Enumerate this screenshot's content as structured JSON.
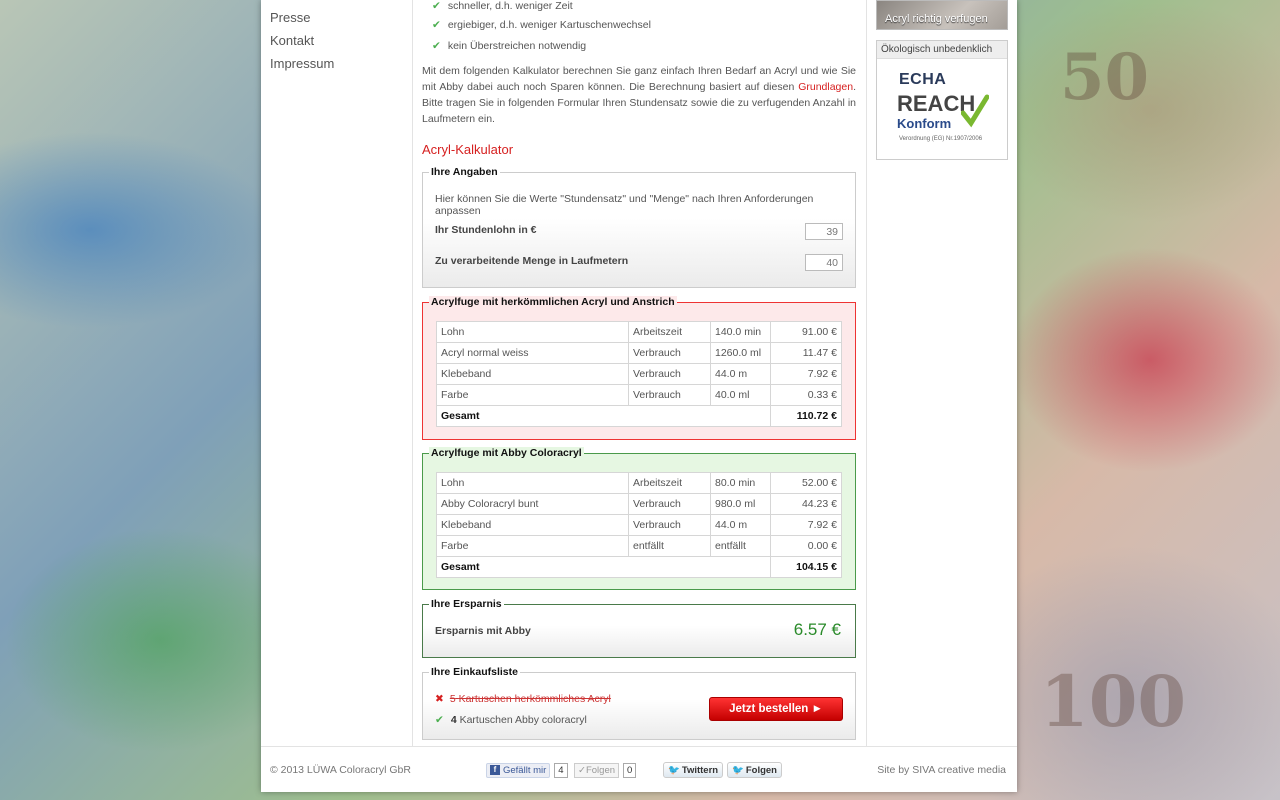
{
  "nav": {
    "items": [
      "Presse",
      "Kontakt",
      "Impressum"
    ]
  },
  "benefits": [
    "schneller, d.h. weniger Zeit",
    "ergiebiger, d.h. weniger Kartuschenwechsel",
    "kein Überstreichen notwendig"
  ],
  "intro": {
    "text_before": "Mit dem folgenden Kalkulator berechnen Sie ganz einfach Ihren Bedarf an Acryl und wie Sie mit Abby dabei auch noch Sparen können. Die Berechnung basiert auf diesen ",
    "link": "Grundlagen",
    "text_after": ". Bitte tragen Sie in folgenden Formular Ihren Stundensatz sowie die zu verfugenden Anzahl in Laufmetern ein."
  },
  "calculator": {
    "title": "Acryl-Kalkulator",
    "inputs": {
      "legend": "Ihre Angaben",
      "hint": "Hier können Sie die Werte \"Stundensatz\" und \"Menge\" nach Ihren Anforderungen anpassen",
      "wage_label": "Ihr Stundenlohn in €",
      "wage_value": "39",
      "quantity_label": "Zu verarbeitende Menge in Laufmetern",
      "quantity_value": "40"
    },
    "conventional": {
      "legend": "Acrylfuge mit herkömmlichen Acryl und Anstrich",
      "rows": [
        [
          "Lohn",
          "Arbeitszeit",
          "140.0 min",
          "91.00 €"
        ],
        [
          "Acryl normal weiss",
          "Verbrauch",
          "1260.0 ml",
          "11.47 €"
        ],
        [
          "Klebeband",
          "Verbrauch",
          "44.0 m",
          "7.92 €"
        ],
        [
          "Farbe",
          "Verbrauch",
          "40.0 ml",
          "0.33 €"
        ]
      ],
      "total_label": "Gesamt",
      "total_value": "110.72 €"
    },
    "abby": {
      "legend": "Acrylfuge mit Abby Coloracryl",
      "rows": [
        [
          "Lohn",
          "Arbeitszeit",
          "80.0 min",
          "52.00 €"
        ],
        [
          "Abby Coloracryl bunt",
          "Verbrauch",
          "980.0 ml",
          "44.23 €"
        ],
        [
          "Klebeband",
          "Verbrauch",
          "44.0 m",
          "7.92 €"
        ],
        [
          "Farbe",
          "entfällt",
          "entfällt",
          "0.00 €"
        ]
      ],
      "total_label": "Gesamt",
      "total_value": "104.15 €"
    },
    "savings": {
      "legend": "Ihre Ersparnis",
      "label": "Ersparnis mit Abby",
      "value": "6.57 €"
    },
    "shopping": {
      "legend": "Ihre Einkaufsliste",
      "item1_qty": "5",
      "item1_text": "Kartuschen herkömmliches Acryl",
      "item2_qty": "4",
      "item2_text": "Kartuschen Abby coloracryl",
      "order_label": "Jetzt bestellen ►"
    }
  },
  "sidebar": {
    "promo_label": "Acryl richtig verfugen",
    "eco_title": "Ökologisch unbedenklich",
    "echa": "ECHA",
    "reach": "REACH",
    "konform": "Konform",
    "verordnung": "Verordnung (EG) Nr.1907/2006"
  },
  "footer": {
    "copyright": "© 2013 LÜWA Coloracryl GbR",
    "fb_like": "Gefällt mir",
    "fb_like_count": "4",
    "follow": "Folgen",
    "follow_count": "0",
    "twitter": "Twittern",
    "twitter_follow": "Folgen",
    "site_by": "Site by SIVA creative media"
  },
  "colors": {
    "accent_red": "#d62020",
    "savings_green": "#2a8a2a"
  }
}
